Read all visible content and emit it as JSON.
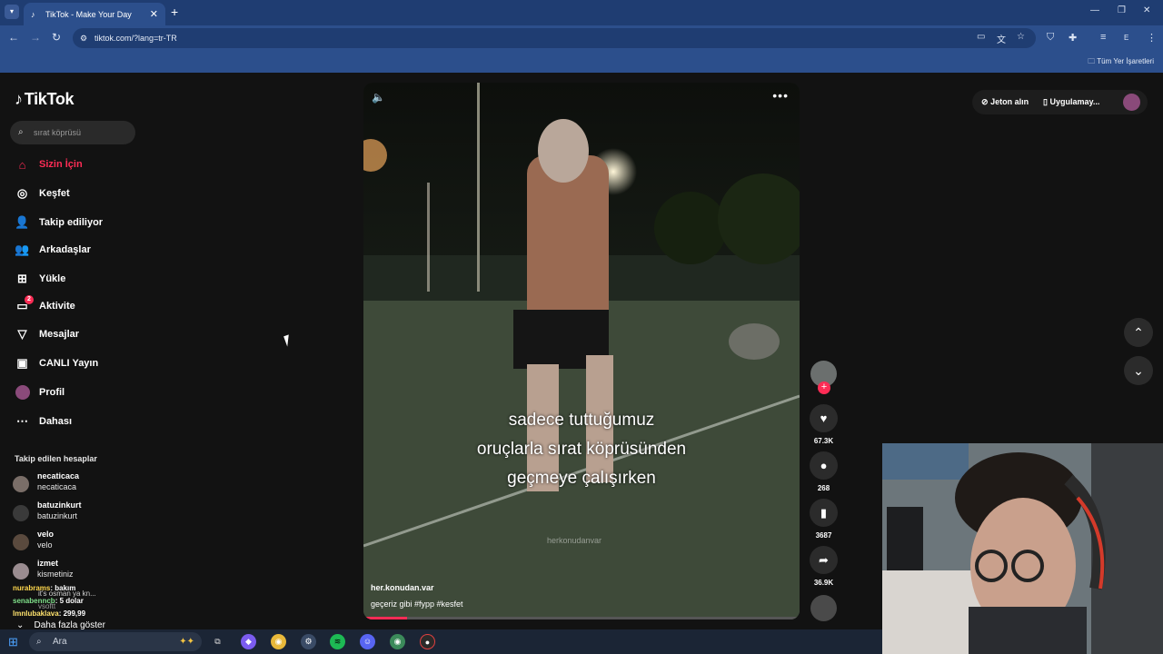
{
  "browser": {
    "tab_title": "TikTok - Make Your Day",
    "tab_close": "✕",
    "new_tab": "+",
    "url": "tiktok.com/?lang=tr-TR",
    "bookmarks_label": "Tüm Yer İşaretleri",
    "profile_initial": "E"
  },
  "tiktok": {
    "logo": "TikTok",
    "search_placeholder": "sırat köprüsü",
    "nav": [
      {
        "label": "Sizin İçin",
        "icon": "home-icon"
      },
      {
        "label": "Keşfet",
        "icon": "compass-icon"
      },
      {
        "label": "Takip ediliyor",
        "icon": "following-icon"
      },
      {
        "label": "Arkadaşlar",
        "icon": "friends-icon"
      },
      {
        "label": "Yükle",
        "icon": "upload-icon"
      },
      {
        "label": "Aktivite",
        "icon": "activity-icon",
        "badge": "2"
      },
      {
        "label": "Mesajlar",
        "icon": "messages-icon"
      },
      {
        "label": "CANLI Yayın",
        "icon": "live-icon"
      },
      {
        "label": "Profil",
        "icon": "profile-icon"
      },
      {
        "label": "Dahası",
        "icon": "more-icon"
      }
    ],
    "followed_title": "Takip edilen hesaplar",
    "followed": [
      {
        "name": "necaticaca",
        "handle": "necaticaca"
      },
      {
        "name": "batuzinkurt",
        "handle": "batuzinkurt"
      },
      {
        "name": "velo",
        "handle": "velo"
      },
      {
        "name": "izmet",
        "handle": "kismetiniz"
      }
    ],
    "show_more": "Daha fazla göster",
    "top_right": {
      "coins": "Jeton alın",
      "app": "Uygulamay..."
    }
  },
  "stream_chat": [
    {
      "user": "nurabrams",
      "text": ": bakım"
    },
    {
      "user": "",
      "text": "it's osman ya kn..."
    },
    {
      "user": "senabenncb",
      "text": ": 5 dolar"
    },
    {
      "user": "",
      "text": "vsoftt"
    },
    {
      "user": "lmnlubaklava",
      "text": ": 299,99"
    }
  ],
  "video": {
    "caption_lines": [
      "sadece tuttuğumuz",
      "oruçlarla sırat köprüsünden",
      "geçmeye çalışırken"
    ],
    "watermark": "herkonudanvar",
    "username": "her.konudan.var",
    "description": "geçeriz gibi #fypp  #kesfet",
    "progress": 0.1,
    "likes": "67.3K",
    "comments": "268",
    "saves": "3687",
    "shares": "36.9K"
  },
  "taskbar": {
    "search_placeholder": "Ara"
  }
}
